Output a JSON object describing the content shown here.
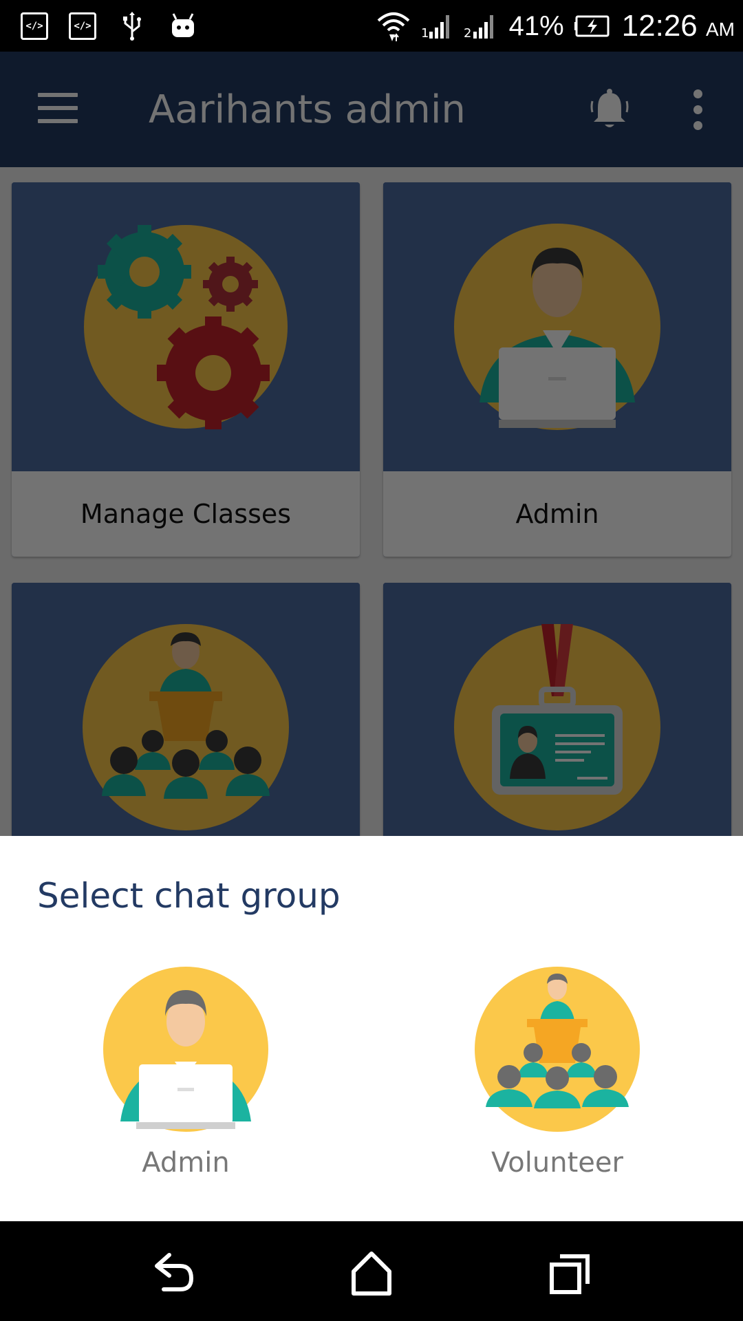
{
  "status_bar": {
    "dev_icon_1": "</>",
    "dev_icon_2": "</>",
    "battery_percent": "41%",
    "time": "12:26",
    "ampm": "AM",
    "icons": [
      "code-icon",
      "code-icon",
      "usb-icon",
      "android-icon",
      "wifi-icon",
      "signal-1-icon",
      "signal-2-icon",
      "battery-charging-icon"
    ]
  },
  "app_bar": {
    "title": "Aarihants admin",
    "icons": [
      "menu-icon",
      "bell-icon",
      "more-vert-icon"
    ]
  },
  "dashboard": {
    "cards": [
      {
        "label": "Manage Classes",
        "icon": "gears-icon"
      },
      {
        "label": "Admin",
        "icon": "admin-person-laptop-icon"
      },
      {
        "label": "",
        "icon": "speaker-audience-icon"
      },
      {
        "label": "",
        "icon": "id-badge-icon"
      }
    ]
  },
  "sheet": {
    "title": "Select chat group",
    "options": [
      {
        "label": "Admin",
        "icon": "admin-person-laptop-icon"
      },
      {
        "label": "Volunteer",
        "icon": "speaker-audience-icon"
      }
    ]
  },
  "nav_bar": {
    "icons": [
      "back-icon",
      "home-icon",
      "recents-icon"
    ]
  },
  "colors": {
    "app_bar": "#233a63",
    "card_bg": "#4d6aa1",
    "circle": "#fbc84a",
    "teal": "#1bb3a0",
    "sheet_title": "#233a63"
  }
}
